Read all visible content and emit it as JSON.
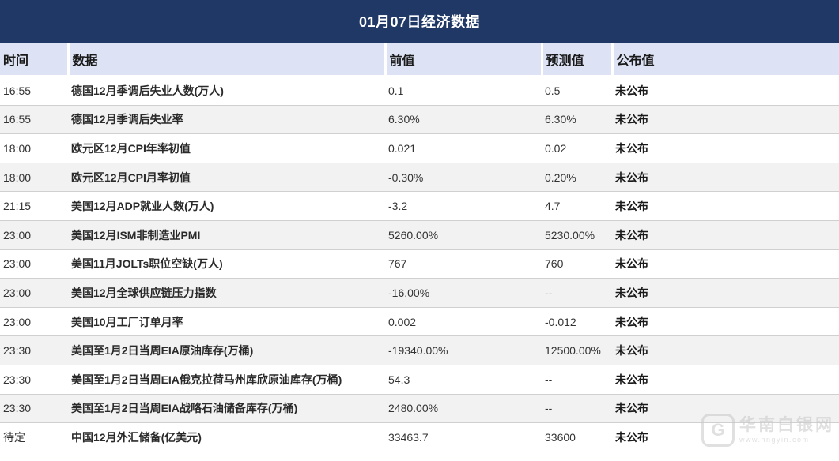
{
  "title": "01月07日经济数据",
  "headers": {
    "time": "时间",
    "data": "数据",
    "previous": "前值",
    "forecast": "预测值",
    "published": "公布值"
  },
  "rows": [
    {
      "time": "16:55",
      "name": "德国12月季调后失业人数(万人)",
      "previous": "0.1",
      "forecast": "0.5",
      "published": "未公布"
    },
    {
      "time": "16:55",
      "name": "德国12月季调后失业率",
      "previous": "6.30%",
      "forecast": "6.30%",
      "published": "未公布"
    },
    {
      "time": "18:00",
      "name": "欧元区12月CPI年率初值",
      "previous": "0.021",
      "forecast": "0.02",
      "published": "未公布"
    },
    {
      "time": "18:00",
      "name": "欧元区12月CPI月率初值",
      "previous": "-0.30%",
      "forecast": "0.20%",
      "published": "未公布"
    },
    {
      "time": "21:15",
      "name": "美国12月ADP就业人数(万人)",
      "previous": "-3.2",
      "forecast": "4.7",
      "published": "未公布"
    },
    {
      "time": "23:00",
      "name": "美国12月ISM非制造业PMI",
      "previous": "5260.00%",
      "forecast": "5230.00%",
      "published": "未公布"
    },
    {
      "time": "23:00",
      "name": "美国11月JOLTs职位空缺(万人)",
      "previous": "767",
      "forecast": "760",
      "published": "未公布"
    },
    {
      "time": "23:00",
      "name": "美国12月全球供应链压力指数",
      "previous": "-16.00%",
      "forecast": "--",
      "published": "未公布"
    },
    {
      "time": "23:00",
      "name": "美国10月工厂订单月率",
      "previous": "0.002",
      "forecast": "-0.012",
      "published": "未公布"
    },
    {
      "time": "23:30",
      "name": "美国至1月2日当周EIA原油库存(万桶)",
      "previous": "-19340.00%",
      "forecast": "12500.00%",
      "published": "未公布"
    },
    {
      "time": "23:30",
      "name": "美国至1月2日当周EIA俄克拉荷马州库欣原油库存(万桶)",
      "previous": "54.3",
      "forecast": "--",
      "published": "未公布"
    },
    {
      "time": "23:30",
      "name": "美国至1月2日当周EIA战略石油储备库存(万桶)",
      "previous": "2480.00%",
      "forecast": "--",
      "published": "未公布"
    },
    {
      "time": "待定",
      "name": "中国12月外汇储备(亿美元)",
      "previous": "33463.7",
      "forecast": "33600",
      "published": "未公布"
    }
  ],
  "watermark": {
    "logo": "G",
    "text": "华南白银网",
    "url": "www.hngyin.com"
  },
  "colors": {
    "title_bg": "#1f3866",
    "header_bg": "#dde3f5",
    "stripe_bg": "#f2f2f2"
  }
}
